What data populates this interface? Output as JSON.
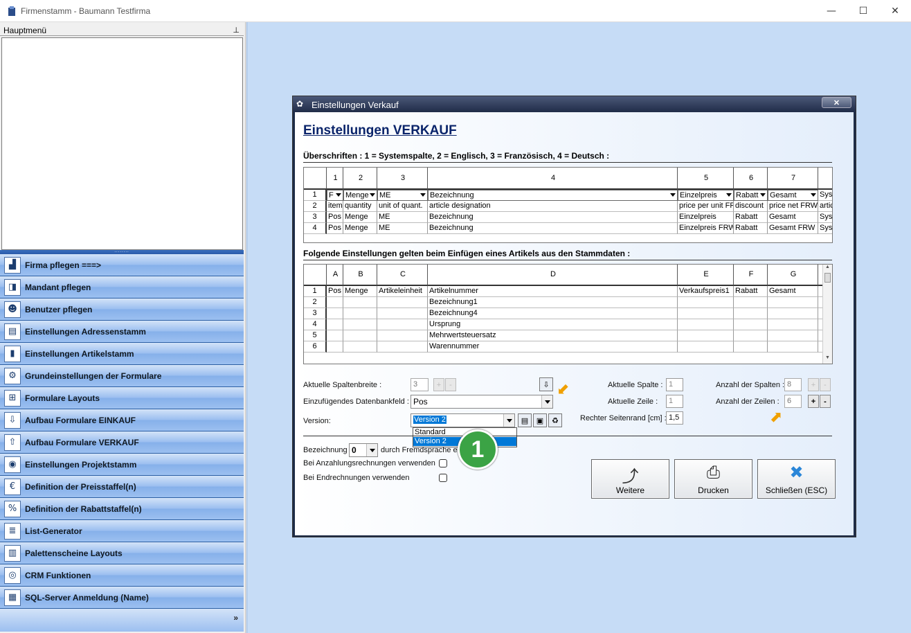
{
  "window": {
    "title": "Firmenstamm - Baumann Testfirma",
    "min": "—",
    "max": "☐",
    "close": "✕"
  },
  "hauptmenu": {
    "title": "Hauptmenü",
    "pin": "⊥"
  },
  "nav": [
    {
      "label": "Firma pflegen   ===>",
      "icon": "factory-icon",
      "glyph": "▟"
    },
    {
      "label": "Mandant pflegen",
      "icon": "client-icon",
      "glyph": "◨"
    },
    {
      "label": "Benutzer pflegen",
      "icon": "users-icon",
      "glyph": "☻"
    },
    {
      "label": "Einstellungen Adressenstamm",
      "icon": "address-card-icon",
      "glyph": "▤"
    },
    {
      "label": "Einstellungen Artikelstamm",
      "icon": "scanner-icon",
      "glyph": "▮"
    },
    {
      "label": "Grundeinstellungen der Formulare",
      "icon": "form-settings-icon",
      "glyph": "⚙"
    },
    {
      "label": "Formulare Layouts",
      "icon": "layout-icon",
      "glyph": "⊞"
    },
    {
      "label": "Aufbau Formulare EINKAUF",
      "icon": "download-tray-icon",
      "glyph": "⇩"
    },
    {
      "label": "Aufbau Formulare VERKAUF",
      "icon": "upload-tray-icon",
      "glyph": "⇧"
    },
    {
      "label": "Einstellungen Projektstamm",
      "icon": "project-icon",
      "glyph": "◉"
    },
    {
      "label": "Definition der Preisstaffel(n)",
      "icon": "price-scale-icon",
      "glyph": "€"
    },
    {
      "label": "Definition der Rabattstaffel(n)",
      "icon": "discount-icon",
      "glyph": "%"
    },
    {
      "label": "List-Generator",
      "icon": "list-icon",
      "glyph": "≣"
    },
    {
      "label": "Palettenscheine Layouts",
      "icon": "pallet-icon",
      "glyph": "▥"
    },
    {
      "label": "CRM Funktionen",
      "icon": "crm-icon",
      "glyph": "◎"
    },
    {
      "label": "SQL-Server Anmeldung (Name)",
      "icon": "sql-server-icon",
      "glyph": "▦"
    }
  ],
  "nav_footer": {
    "chevron": "»"
  },
  "dialog": {
    "title": "Einstellungen Verkauf",
    "close": "✕",
    "heading": "Einstellungen VERKAUF",
    "section1": "Überschriften : 1 = Systemspalte, 2 = Englisch, 3 = Französisch, 4 = Deutsch :",
    "grid1": {
      "cols": [
        "1",
        "2",
        "3",
        "4",
        "5",
        "6",
        "7",
        ""
      ],
      "rows": [
        {
          "n": "1",
          "cells": [
            "F",
            "Menge",
            "ME",
            "Bezeichnung",
            "Einzelpreis",
            "Rabatt",
            "Gesamt",
            "Sys"
          ]
        },
        {
          "n": "2",
          "cells": [
            "item",
            "quantity",
            "unit of quant.",
            "article designation",
            "price per unit FR",
            "discount",
            "price net FRW",
            "artic"
          ]
        },
        {
          "n": "3",
          "cells": [
            "Pos",
            "Menge",
            "ME",
            "Bezeichnung",
            "Einzelpreis",
            "Rabatt",
            "Gesamt",
            "Sys"
          ]
        },
        {
          "n": "4",
          "cells": [
            "Pos",
            "Menge",
            "ME",
            "Bezeichnung",
            "Einzelpreis FRW",
            "Rabatt",
            "Gesamt FRW",
            "Sys"
          ]
        }
      ]
    },
    "section2": "Folgende Einstellungen gelten beim Einfügen eines Artikels aus den Stammdaten :",
    "grid2": {
      "cols": [
        "A",
        "B",
        "C",
        "D",
        "E",
        "F",
        "G",
        ""
      ],
      "rows": [
        {
          "n": "1",
          "cells": [
            "Pos",
            "Menge",
            "Artikeleinheit",
            "Artikelnummer",
            "Verkaufspreis1",
            "Rabatt",
            "Gesamt",
            ""
          ]
        },
        {
          "n": "2",
          "cells": [
            "",
            "",
            "",
            "Bezeichnung1",
            "",
            "",
            "",
            ""
          ]
        },
        {
          "n": "3",
          "cells": [
            "",
            "",
            "",
            "Bezeichnung4",
            "",
            "",
            "",
            ""
          ]
        },
        {
          "n": "4",
          "cells": [
            "",
            "",
            "",
            "Ursprung",
            "",
            "",
            "",
            ""
          ]
        },
        {
          "n": "5",
          "cells": [
            "",
            "",
            "",
            "Mehrwertsteuersatz",
            "",
            "",
            "",
            ""
          ]
        },
        {
          "n": "6",
          "cells": [
            "",
            "",
            "",
            "Warennummer",
            "",
            "",
            "",
            ""
          ]
        }
      ]
    },
    "spaltenbreite_label": "Aktuelle Spaltenbreite :",
    "spaltenbreite_value": "3",
    "datenbankfeld_label": "Einzufügendes Datenbankfeld :",
    "datenbankfeld_value": "Pos",
    "version_label": "Version:",
    "version_value": "Version 2",
    "version_options": [
      "Standard",
      "Version 2"
    ],
    "aktuelle_spalte_label": "Aktuelle Spalte :",
    "aktuelle_spalte_value": "1",
    "aktuelle_zeile_label": "Aktuelle Zeile :",
    "aktuelle_zeile_value": "1",
    "seitenrand_label": "Rechter Seitenrand [cm] :",
    "seitenrand_value": "1,5",
    "anzahl_spalten_label": "Anzahl der Spalten :",
    "anzahl_spalten_value": "8",
    "anzahl_zeilen_label": "Anzahl der Zeilen :",
    "anzahl_zeilen_value": "6",
    "plus": "+",
    "minus": "-",
    "bezeichnung_label": "Bezeichnung",
    "bezeichnung_value": "0",
    "fremdsprache_text": "durch Fremdsprache ers",
    "anzahlung_label": "Bei Anzahlungsrechnungen verwenden",
    "endrechnung_label": "Bei Endrechnungen verwenden",
    "btn_weitere": "Weitere",
    "btn_drucken": "Drucken",
    "btn_schliessen": "Schließen (ESC)",
    "badge": "1"
  }
}
